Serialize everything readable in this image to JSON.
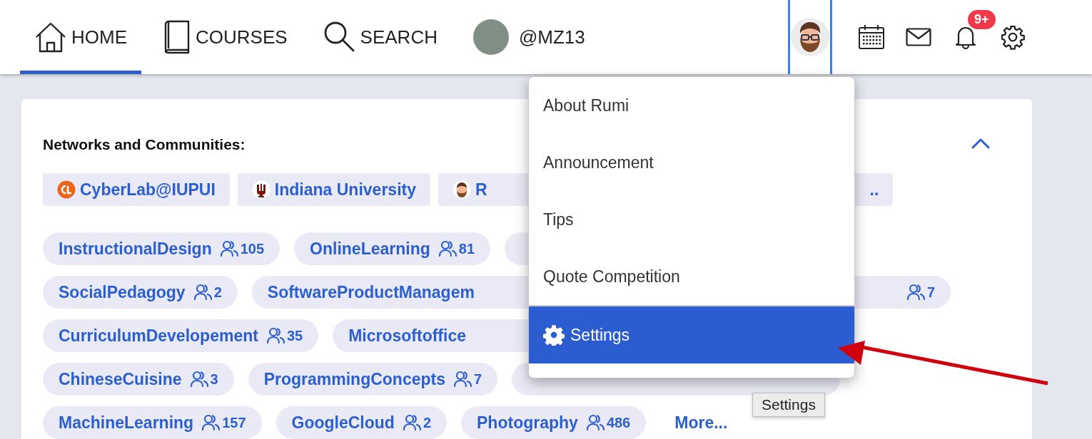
{
  "nav": {
    "items": [
      {
        "kind": "home",
        "label": "HOME",
        "selected": true
      },
      {
        "kind": "courses",
        "label": "COURSES",
        "selected": false
      },
      {
        "kind": "search",
        "label": "SEARCH",
        "selected": false
      },
      {
        "kind": "profile",
        "label": "@MZ13",
        "selected": false
      }
    ]
  },
  "toolbar": {
    "avatar_selected": true,
    "notification_badge": "9+"
  },
  "section": {
    "title": "Networks and Communities:",
    "expanded": true
  },
  "networks": [
    {
      "kind": "cyberlab",
      "label": "CyberLab@IUPUI"
    },
    {
      "kind": "iu",
      "label": "Indiana University"
    },
    {
      "kind": "avatar-cut",
      "label": "R"
    },
    {
      "kind": "tail",
      "label": ".."
    }
  ],
  "communities": [
    [
      {
        "kind": "full",
        "label": "InstructionalDesign",
        "count": "105"
      },
      {
        "kind": "full",
        "label": "OnlineLearning",
        "count": "81"
      },
      {
        "kind": "covered"
      }
    ],
    [
      {
        "kind": "full",
        "label": "SocialPedagogy",
        "count": "2"
      },
      {
        "kind": "cut",
        "label": "SoftwareProductManagem"
      },
      {
        "kind": "tail",
        "count": "7"
      }
    ],
    [
      {
        "kind": "full",
        "label": "CurriculumDevelopement",
        "count": "35"
      },
      {
        "kind": "cut",
        "label": "Microsoftoffice"
      }
    ],
    [
      {
        "kind": "full",
        "label": "ChineseCuisine",
        "count": "3"
      },
      {
        "kind": "full",
        "label": "ProgrammingConcepts",
        "count": "7"
      },
      {
        "kind": "covered"
      }
    ],
    [
      {
        "kind": "full",
        "label": "MachineLearning",
        "count": "157"
      },
      {
        "kind": "full",
        "label": "GoogleCloud",
        "count": "2"
      },
      {
        "kind": "full",
        "label": "Photography",
        "count": "486"
      },
      {
        "kind": "link",
        "label": "More..."
      }
    ]
  ],
  "menu": {
    "items": [
      {
        "kind": "plain",
        "label": "About Rumi",
        "selected": false
      },
      {
        "kind": "plain",
        "label": "Announcement",
        "selected": false
      },
      {
        "kind": "plain",
        "label": "Tips",
        "selected": false
      },
      {
        "kind": "plain",
        "label": "Quote Competition",
        "selected": false
      },
      {
        "kind": "gear",
        "label": "Settings",
        "selected": true
      }
    ]
  },
  "tooltip": "Settings"
}
